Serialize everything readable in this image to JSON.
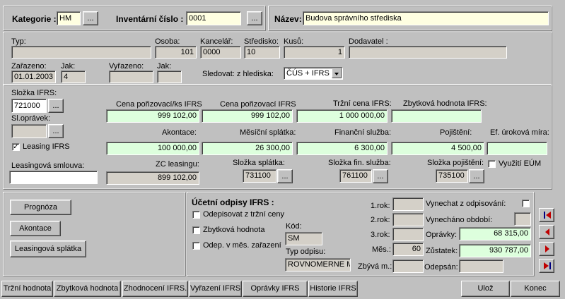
{
  "header": {
    "kategorie_label": "Kategorie :",
    "kategorie_value": "HM",
    "inventarni_label": "Inventární číslo :",
    "inventarni_value": "0001",
    "nazev_label": "Název:",
    "nazev_value": "Budova správního střediska",
    "browse_label": "..."
  },
  "info": {
    "typ_label": "Typ:",
    "typ_value": "",
    "osoba_label": "Osoba:",
    "osoba_value": "101",
    "kancelar_label": "Kancelář:",
    "kancelar_value": "0000",
    "stredisko_label": "Středisko:",
    "stredisko_value": "10",
    "kusu_label": "Kusů:",
    "kusu_value": "1",
    "dodavatel_label": "Dodavatel :",
    "dodavatel_value": "",
    "zarazeno_label": "Zařazeno:",
    "zarazeno_value": "01.01.2003",
    "jak1_label": "Jak:",
    "jak1_value": "4",
    "vyrazeno_label": "Vyřazeno:",
    "vyrazeno_value": "",
    "jak2_label": "Jak:",
    "jak2_value": "",
    "sledovat_label": "Sledovat: z hlediska:",
    "sledovat_value": "ČÚS + IFRS"
  },
  "ifrs": {
    "slozka_label": "Složka IFRS:",
    "slozka_value": "721000",
    "slopravek_label": "Sl.oprávek:",
    "slopravek_value": "",
    "leasing_label": "Leasing IFRS",
    "leasing_checked": "✓",
    "smlouva_label": "Leasingová smlouva:",
    "smlouva_value": "",
    "cena_ifrs_label": "Cena pořizovací/ks IFRS",
    "cena_ifrs_value": "999 102,00",
    "cena_label": "Cena pořizovací IFRS",
    "cena_value": "999 102,00",
    "trzni_label": "Tržní cena IFRS:",
    "trzni_value": "1 000 000,00",
    "zbytkova_label": "Zbytková hodnota IFRS:",
    "zbytkova_value": "",
    "akontace_label": "Akontace:",
    "akontace_value": "100 000,00",
    "mesicni_label": "Měsíční splátka:",
    "mesicni_value": "26 300,00",
    "financni_label": "Finanční služba:",
    "financni_value": "6 300,00",
    "pojisteni_label": "Pojištění:",
    "pojisteni_value": "4 500,00",
    "ef_label": "Ef. úroková míra:",
    "ef_value": "",
    "zc_label": "ZC leasingu:",
    "zc_value": "899 102,00",
    "sl_splatka_label": "Složka splátka:",
    "sl_splatka_value": "731100",
    "sl_fin_label": "Složka fin. služba:",
    "sl_fin_value": "761100",
    "sl_poj_label": "Složka pojištění:",
    "sl_poj_value": "735100",
    "vyuziti_label": "Využití EÚM"
  },
  "actions": {
    "prognoza": "Prognóza",
    "akontace": "Akontace",
    "leasingova_splatka": "Leasingová splátka"
  },
  "odpisy": {
    "title": "Účetní odpisy IFRS :",
    "opt1": "Odepisovat z tržní ceny",
    "opt2": "Zbytková  hodnota",
    "opt3": "Odep. v měs. zařazení",
    "kod_label": "Kód:",
    "kod_value": "SM",
    "typ_label": "Typ odpisu:",
    "typ_value": "ROVNOMERNE M",
    "rok1_label": "1.rok:",
    "rok2_label": "2.rok:",
    "rok3_label": "3.rok:",
    "mes_label": "Měs.:",
    "mes_value": "60",
    "zbyva_label": "Zbývá m.:",
    "vynechat_label": "Vynechat z odpisování:",
    "vynechano_label": "Vynecháno období:",
    "opravky_label": "Oprávky:",
    "opravky_value": "68 315,00",
    "zustatek_label": "Zůstatek:",
    "zustatek_value": "930 787,00",
    "odepsan_label": "Odepsán:",
    "odepsan_value": ""
  },
  "bottom_tabs": [
    "Tržní hodnota",
    "Zbytková hodnota",
    "Zhodnocení IFRS.",
    "Vyřazení IFRS",
    "Oprávky IFRS",
    "Historie IFRS"
  ],
  "footer": {
    "uloz": "Ulož",
    "konec": "Konec"
  },
  "colors": {
    "green": "#ddffdd",
    "yellow": "#ffffe1",
    "nav_red": "#c00000",
    "nav_navy": "#000080"
  }
}
